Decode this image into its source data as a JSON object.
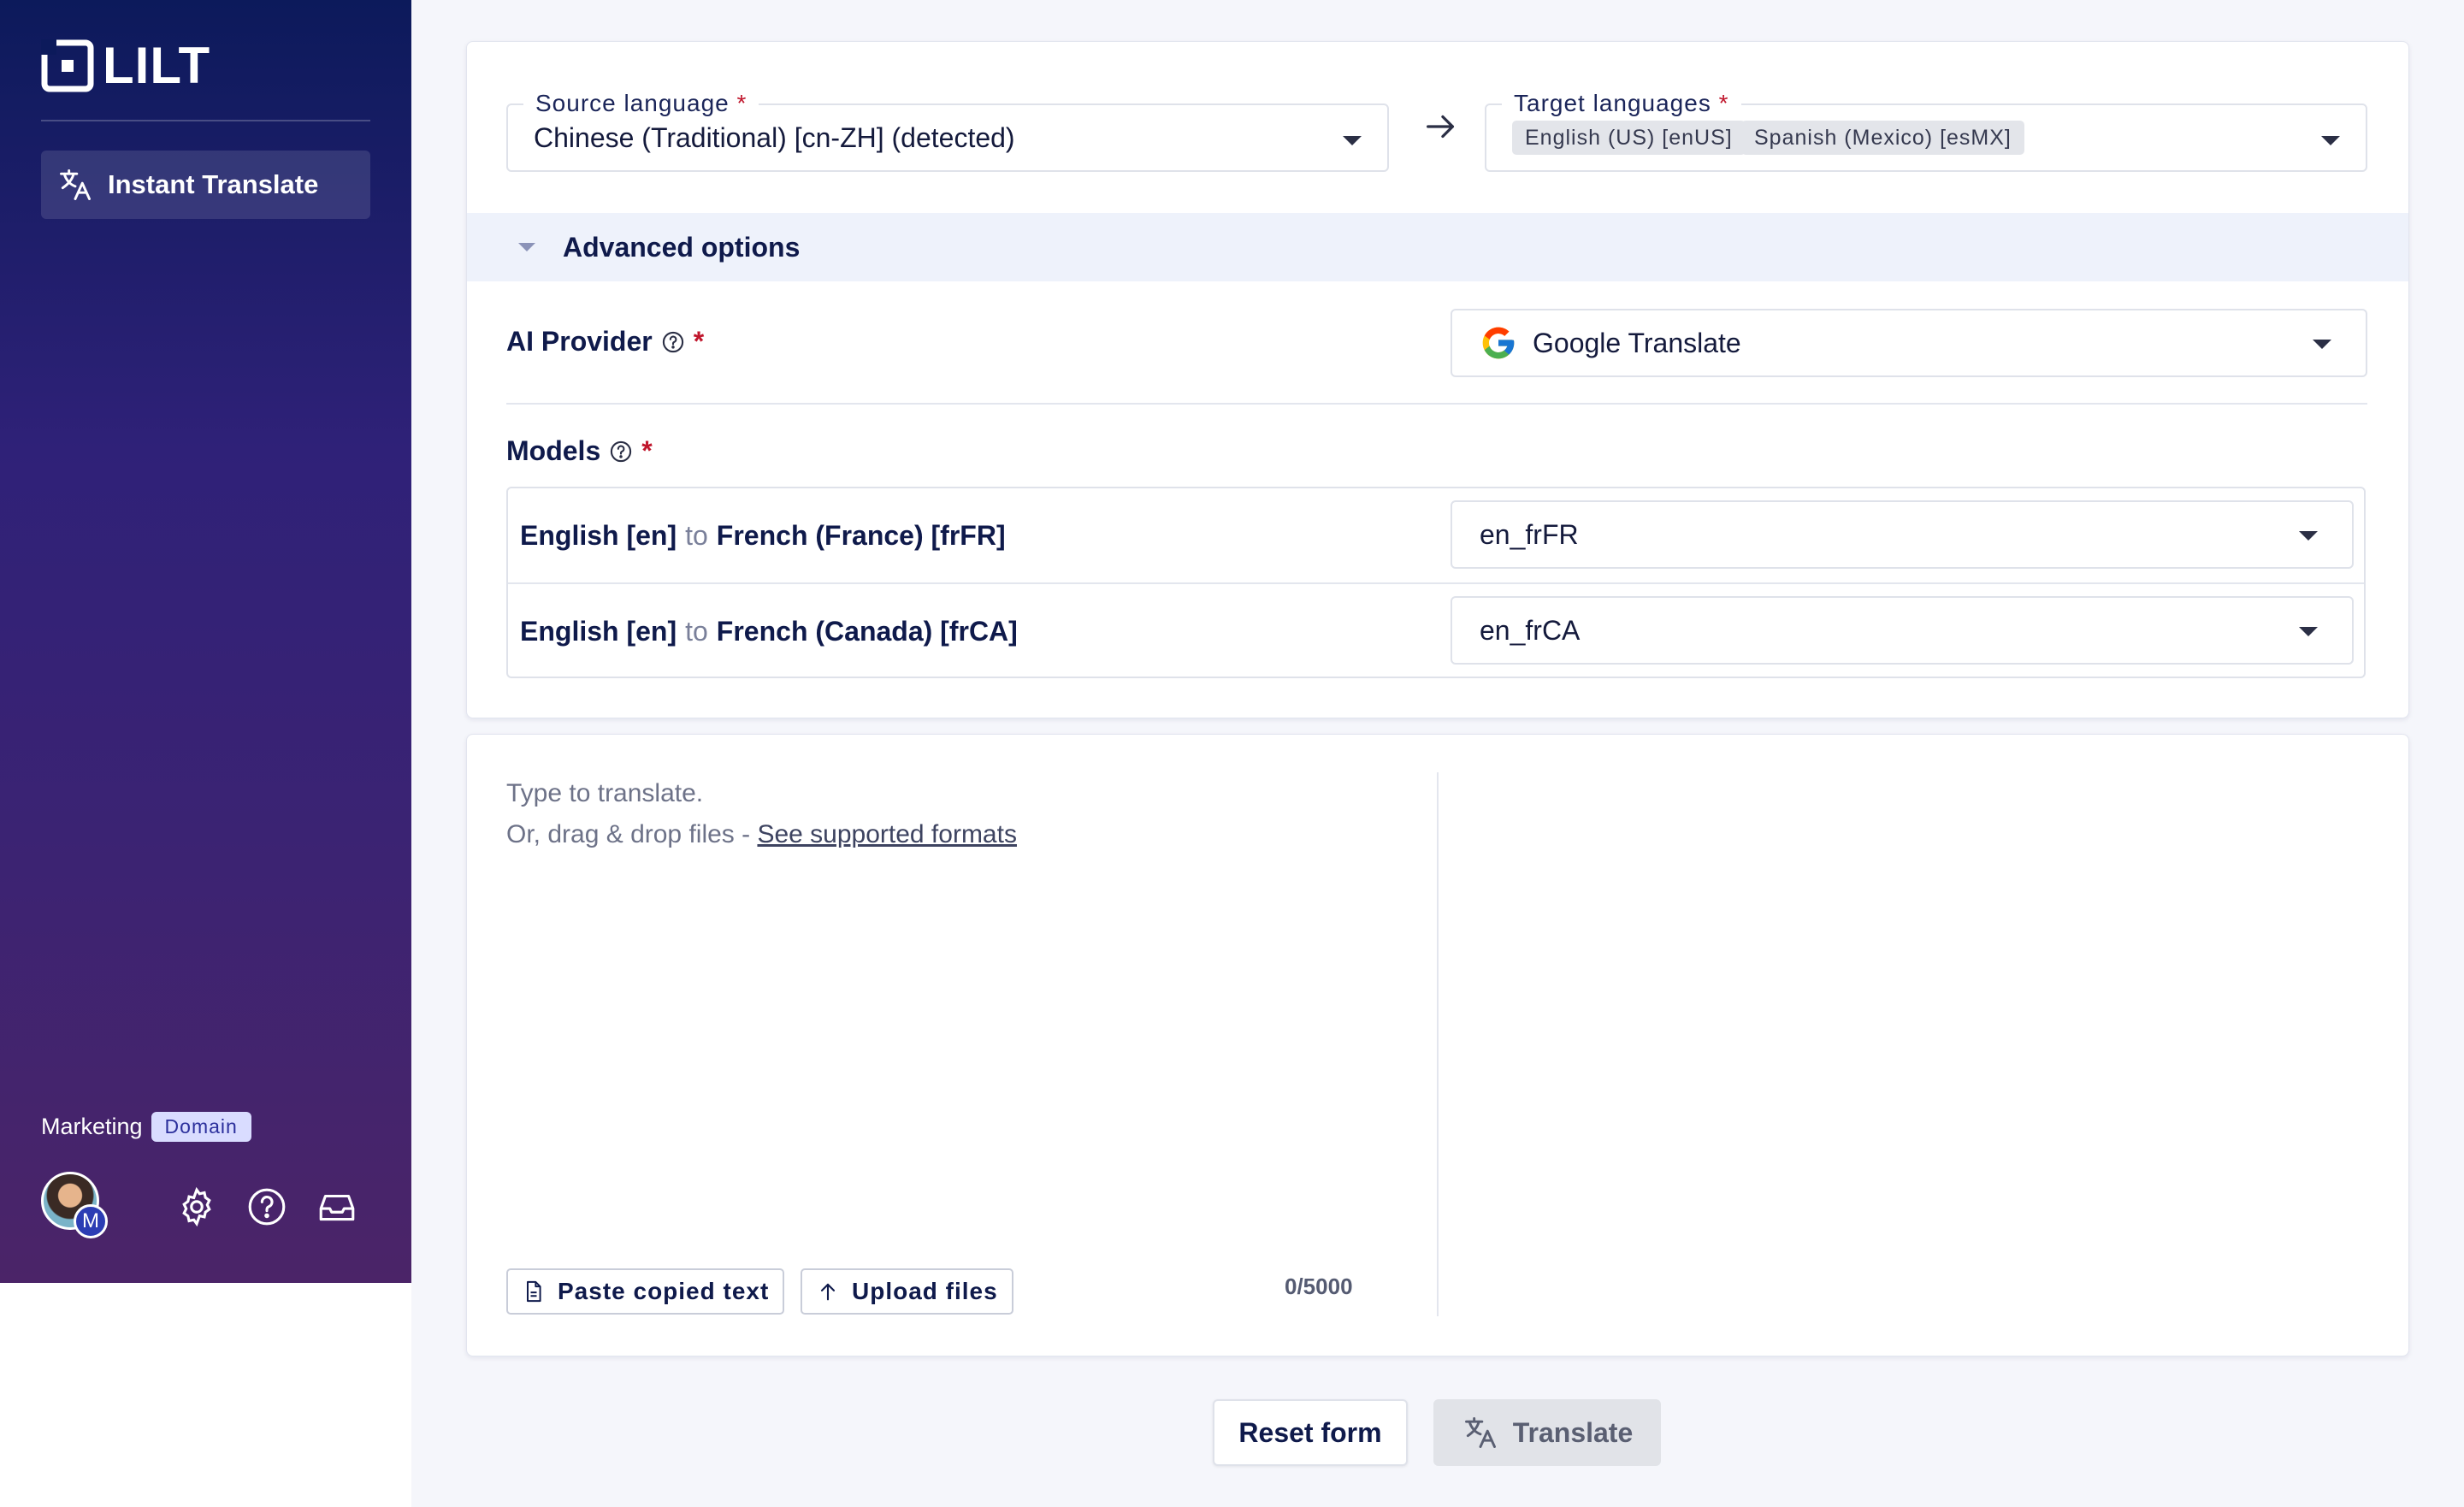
{
  "app": {
    "name": "LILT"
  },
  "sidebar": {
    "nav_items": [
      {
        "label": "Instant Translate"
      }
    ],
    "workspace": {
      "name": "Marketing",
      "badge": "Domain"
    },
    "avatar_initial": "M"
  },
  "source": {
    "label": "Source language",
    "required_mark": "*",
    "value": "Chinese (Traditional) [cn-ZH] (detected)"
  },
  "target": {
    "label": "Target languages",
    "required_mark": "*",
    "chips": [
      "English (US) [enUS]",
      "Spanish (Mexico) [esMX]"
    ]
  },
  "advanced": {
    "label": "Advanced options"
  },
  "ai_provider": {
    "label": "AI Provider",
    "required_mark": "*",
    "value": "Google Translate"
  },
  "models": {
    "label": "Models",
    "required_mark": "*",
    "rows": [
      {
        "source": "English [en]",
        "connector": "to",
        "target": "French (France) [frFR]",
        "value": "en_frFR"
      },
      {
        "source": "English [en]",
        "connector": "to",
        "target": "French (Canada) [frCA]",
        "value": "en_frCA"
      }
    ]
  },
  "input": {
    "placeholder_line1": "Type to translate.",
    "placeholder_line2": "Or, drag & drop files - ",
    "formats_link": "See supported formats",
    "paste_label": "Paste copied text",
    "upload_label": "Upload files",
    "counter": "0/5000"
  },
  "actions": {
    "reset_label": "Reset form",
    "translate_label": "Translate"
  },
  "colors": {
    "sidebar_top": "#0c1a5b",
    "sidebar_bottom": "#4b2468",
    "required": "#c0162c",
    "text_primary": "#0f1a4b"
  }
}
